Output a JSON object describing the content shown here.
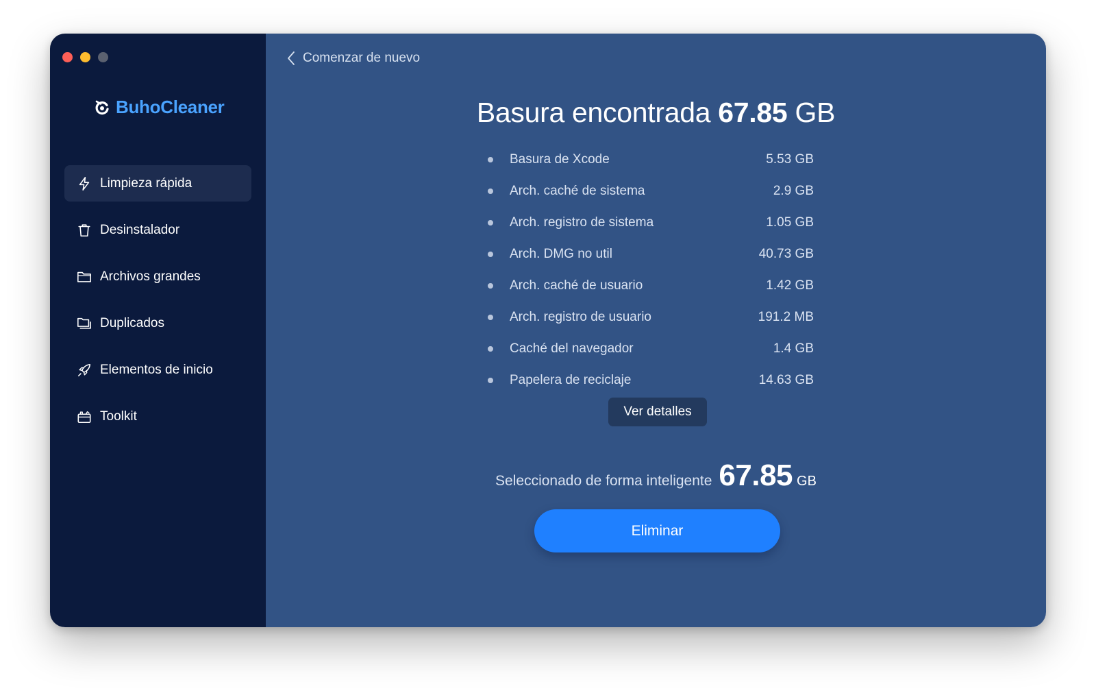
{
  "app": {
    "name": "BuhoCleaner",
    "accent_color": "#4aa3ff"
  },
  "window_controls": [
    "close",
    "minimize",
    "zoom"
  ],
  "sidebar": {
    "items": [
      {
        "label": "Limpieza rápida",
        "icon": "lightning-icon",
        "active": true
      },
      {
        "label": "Desinstalador",
        "icon": "trash-icon",
        "active": false
      },
      {
        "label": "Archivos grandes",
        "icon": "folder-icon",
        "active": false
      },
      {
        "label": "Duplicados",
        "icon": "duplicate-folder-icon",
        "active": false
      },
      {
        "label": "Elementos de inicio",
        "icon": "rocket-icon",
        "active": false
      },
      {
        "label": "Toolkit",
        "icon": "toolkit-icon",
        "active": false
      }
    ]
  },
  "header": {
    "back_label": "Comenzar de nuevo"
  },
  "summary": {
    "title_prefix": "Basura encontrada",
    "total_value": "67.85",
    "total_unit": "GB"
  },
  "junk_items": [
    {
      "name": "Basura de Xcode",
      "size": "5.53 GB"
    },
    {
      "name": "Arch. caché de sistema",
      "size": "2.9 GB"
    },
    {
      "name": "Arch. registro de sistema",
      "size": "1.05 GB"
    },
    {
      "name": "Arch. DMG no util",
      "size": "40.73 GB"
    },
    {
      "name": "Arch. caché de usuario",
      "size": "1.42 GB"
    },
    {
      "name": "Arch. registro de usuario",
      "size": "191.2 MB"
    },
    {
      "name": "Caché del navegador",
      "size": "1.4 GB"
    },
    {
      "name": "Papelera de reciclaje",
      "size": "14.63 GB"
    }
  ],
  "details_button": "Ver detalles",
  "selection": {
    "label": "Seleccionado de forma inteligente",
    "value": "67.85",
    "unit": "GB"
  },
  "delete_button": "Eliminar",
  "colors": {
    "sidebar_bg": "#0b1a3d",
    "main_bg": "#325385",
    "primary_button": "#1f80ff"
  }
}
